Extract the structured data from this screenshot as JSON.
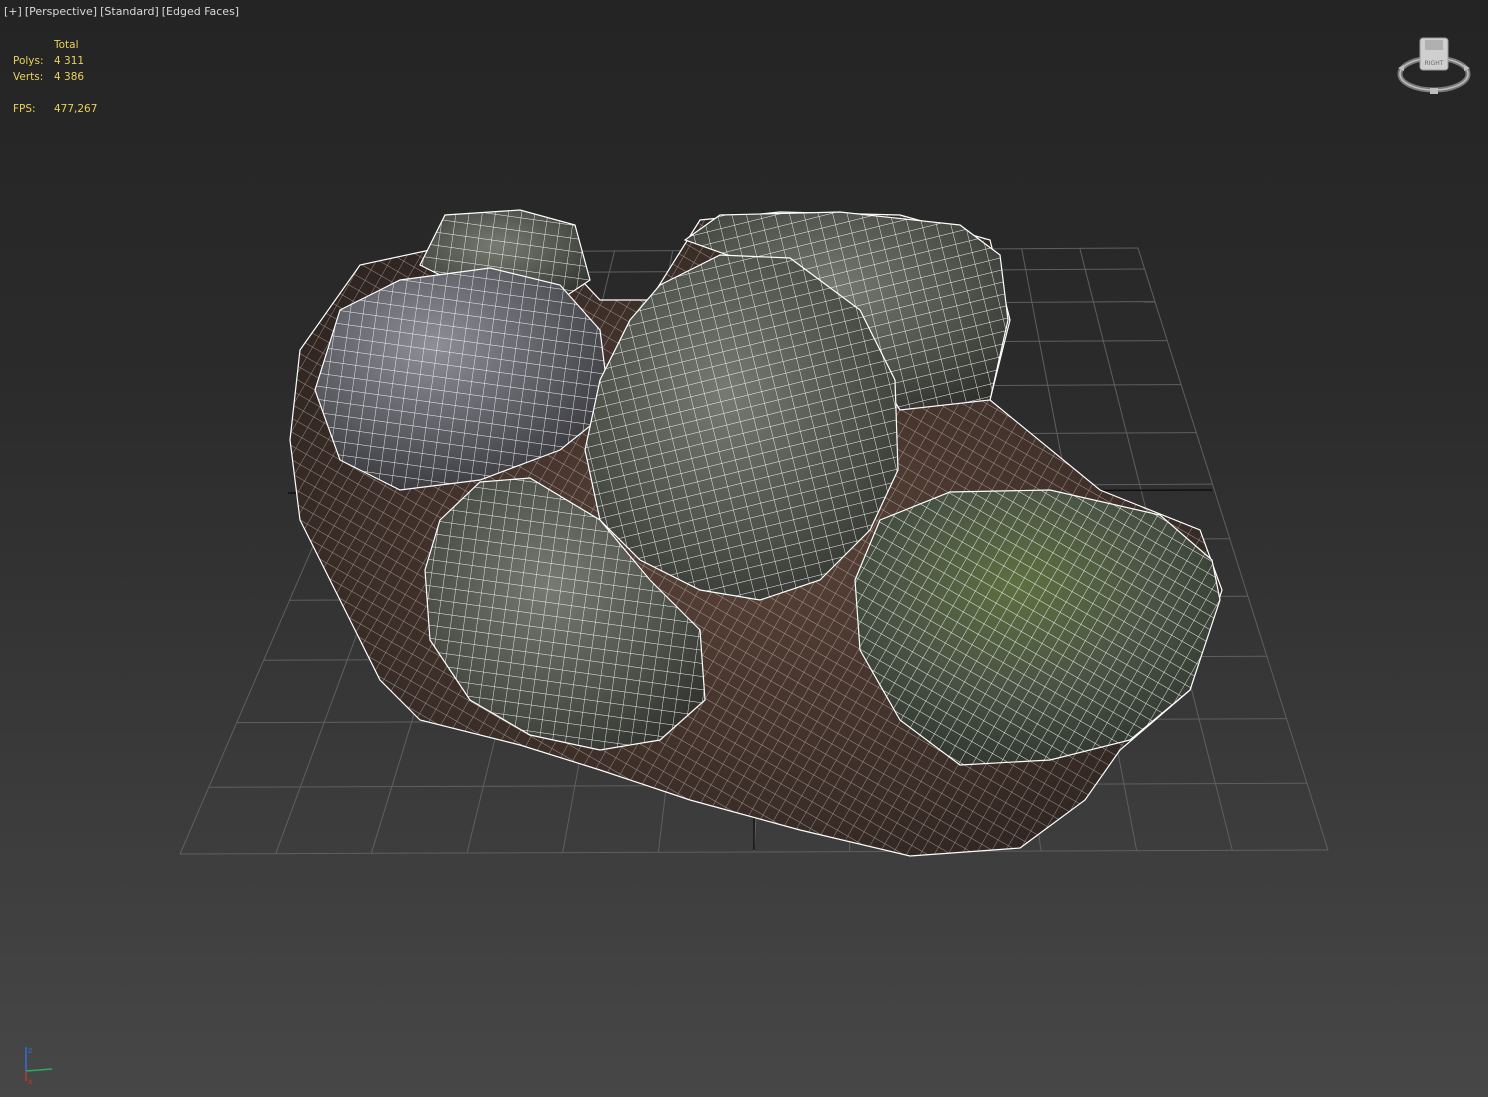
{
  "viewport": {
    "labels": [
      "[+]",
      "[Perspective]",
      "[Standard]",
      "[Edged Faces]"
    ]
  },
  "stats": {
    "header": "Total",
    "polys_label": "Polys:",
    "polys_value": "4 311",
    "verts_label": "Verts:",
    "verts_value": "4 386",
    "fps_label": "FPS:",
    "fps_value": "477,267"
  },
  "viewcube": {
    "face_label": "RIGHT",
    "icon": "viewcube-icon"
  },
  "axis_tripod": {
    "x_label": "x",
    "z_label": "z",
    "icon": "axis-tripod-icon"
  },
  "colors": {
    "stats_text": "#e8d25a",
    "label_text": "#d9d9d9",
    "wire": "#ffffff",
    "grid": "#5f5f5f",
    "axis_x": "#c0392b",
    "axis_y": "#27ae60",
    "axis_z": "#2e6fd8"
  }
}
